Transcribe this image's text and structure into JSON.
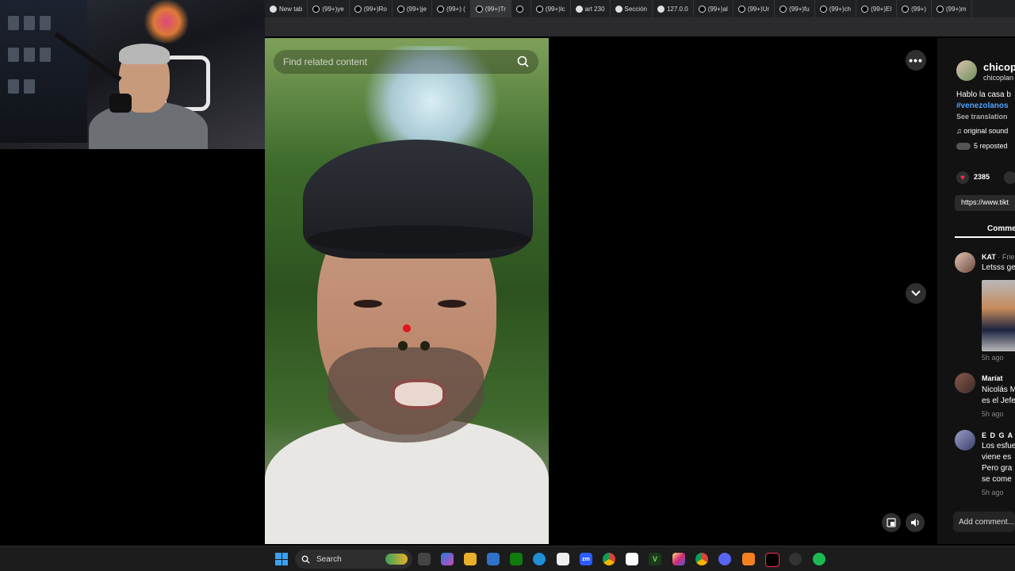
{
  "browser": {
    "tabs": [
      {
        "label": "New tab",
        "icon": "new-tab-icon"
      },
      {
        "label": "(99+)ye",
        "icon": "tiktok-icon"
      },
      {
        "label": "(99+)Ro",
        "icon": "tiktok-icon"
      },
      {
        "label": "(99+)je",
        "icon": "tiktok-icon"
      },
      {
        "label": "(99+) (",
        "icon": "tiktok-icon"
      },
      {
        "label": "(99+)Tr",
        "icon": "tiktok-icon",
        "active": true
      },
      {
        "label": "",
        "icon": "tiktok-icon"
      },
      {
        "label": "(99+)lc",
        "icon": "tiktok-icon"
      },
      {
        "label": "art 230",
        "icon": "page-icon"
      },
      {
        "label": "Sección",
        "icon": "page-icon"
      },
      {
        "label": "127.0.0",
        "icon": "page-icon"
      },
      {
        "label": "(99+)al",
        "icon": "tiktok-icon"
      },
      {
        "label": "(99+)Ur",
        "icon": "tiktok-icon"
      },
      {
        "label": "(99+)fu",
        "icon": "tiktok-icon"
      },
      {
        "label": "(99+)ch",
        "icon": "tiktok-icon"
      },
      {
        "label": "(99+)El",
        "icon": "tiktok-icon"
      },
      {
        "label": "(99+)",
        "icon": "tiktok-icon"
      },
      {
        "label": "(99+)m",
        "icon": "tiktok-icon"
      }
    ]
  },
  "video": {
    "search_placeholder": "Find related content"
  },
  "panel": {
    "creator_name": "chicop",
    "creator_handle": "chicoplan",
    "description": "Hablo la casa b",
    "hashtag": "#venezolanos",
    "see_translation": "See translation",
    "sound": "original sound",
    "reposted": "5 reposted",
    "like_count": "2385",
    "link": "https://www.tikt",
    "comments_tab": "Comme",
    "comments": [
      {
        "author": "KAT",
        "meta": " · Frie",
        "text": "Letsss ge",
        "time": "5h ago"
      },
      {
        "author": "Maríat",
        "meta": "",
        "text": "Nicolás M",
        "text2": "es el Jefe",
        "time": "5h ago"
      },
      {
        "author": "E D G A R",
        "meta": "",
        "text": "Los esfue",
        "text2": "viene es",
        "text3": "Pero gra",
        "text4": "se come",
        "time": "5h ago"
      }
    ],
    "add_comment": "Add comment..."
  },
  "taskbar": {
    "search_label": "Search"
  },
  "colors": {
    "accent_like": "#fe2c55",
    "hashtag": "#4da3ff",
    "record_dot": "#e3121b"
  }
}
